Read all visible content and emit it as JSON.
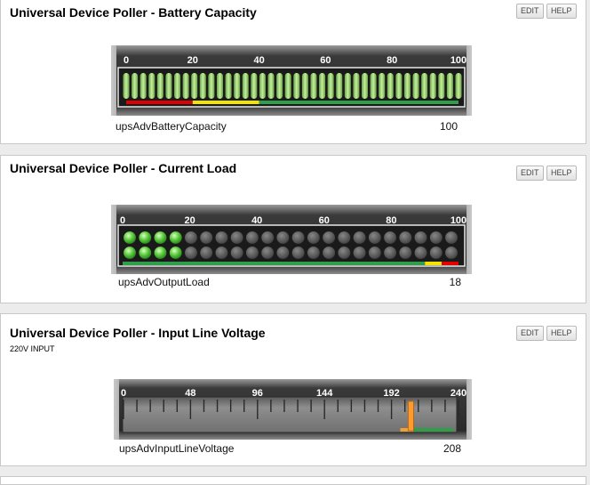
{
  "panels": [
    {
      "title": "Universal Device Poller - Battery Capacity",
      "subtitle": "",
      "edit_label": "EDIT",
      "help_label": "HELP",
      "gauge": {
        "style": "bar-segments",
        "ticks": [
          "0",
          "20",
          "40",
          "60",
          "80",
          "100"
        ],
        "min": 0,
        "max": 100,
        "value": 100,
        "variable": "upsAdvBatteryCapacity",
        "value_label": "100",
        "zones": [
          {
            "from": 0,
            "to": 20,
            "color": "#e00000"
          },
          {
            "from": 20,
            "to": 40,
            "color": "#f2e400"
          },
          {
            "from": 40,
            "to": 100,
            "color": "#2f9d4a"
          }
        ]
      }
    },
    {
      "title": "Universal Device Poller - Current Load",
      "subtitle": "",
      "edit_label": "EDIT",
      "help_label": "HELP",
      "gauge": {
        "style": "led-dots",
        "ticks": [
          "0",
          "20",
          "40",
          "60",
          "80",
          "100"
        ],
        "min": 0,
        "max": 100,
        "value": 18,
        "variable": "upsAdvOutputLoad",
        "value_label": "18",
        "zones": [
          {
            "from": 0,
            "to": 90,
            "color": "#2f9d4a"
          },
          {
            "from": 90,
            "to": 95,
            "color": "#f2e400"
          },
          {
            "from": 95,
            "to": 100,
            "color": "#e00000"
          }
        ]
      }
    },
    {
      "title": "Universal Device Poller - Input Line Voltage",
      "subtitle": "220V INPUT",
      "edit_label": "EDIT",
      "help_label": "HELP",
      "gauge": {
        "style": "linear-scale",
        "ticks": [
          "0",
          "48",
          "96",
          "144",
          "192",
          "240"
        ],
        "min": 0,
        "max": 240,
        "value": 208,
        "variable": "upsAdvInputLineVoltage",
        "value_label": "208",
        "zones": [
          {
            "from": 200,
            "to": 210,
            "color": "#f0a030"
          },
          {
            "from": 210,
            "to": 240,
            "color": "#2f9d4a"
          }
        ]
      }
    }
  ]
}
